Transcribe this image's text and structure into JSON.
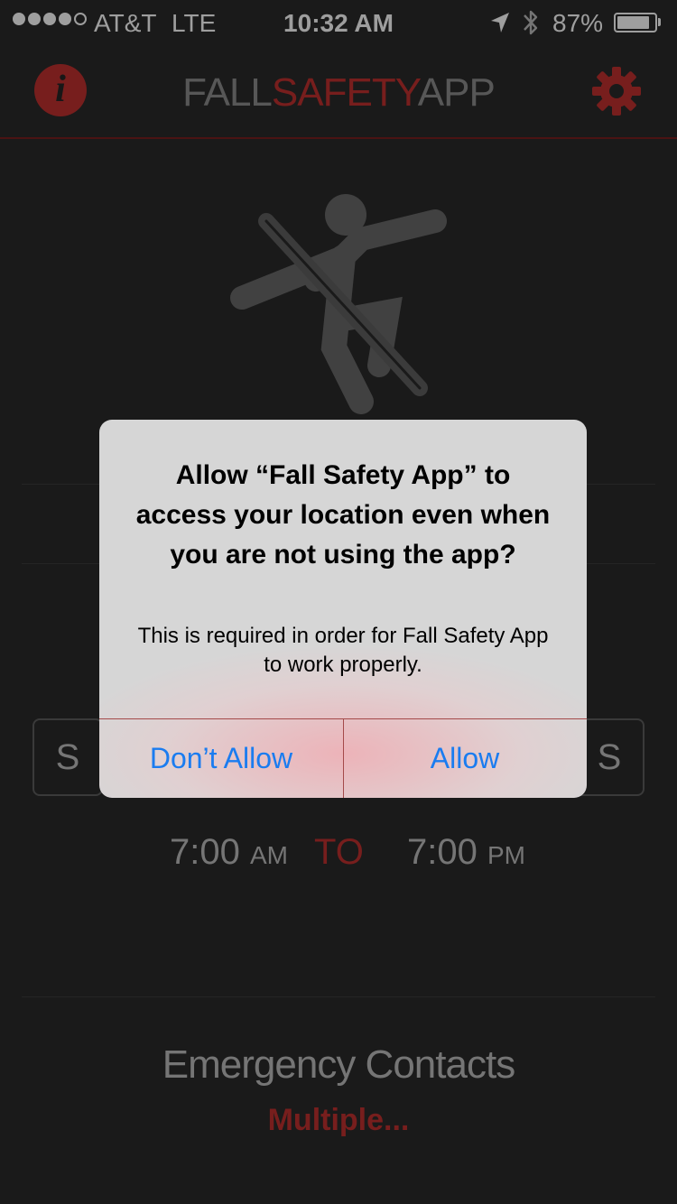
{
  "status_bar": {
    "carrier": "AT&T",
    "network": "LTE",
    "time": "10:32 AM",
    "battery_percent": "87%",
    "battery_level": 0.87,
    "signal_filled": 4,
    "signal_total": 5,
    "icons": [
      "location-arrow-icon",
      "bluetooth-icon",
      "battery-icon"
    ]
  },
  "header": {
    "title_part1": "FALL",
    "title_part2": "SAFETY",
    "title_part3": "APP",
    "info_glyph": "i",
    "icons": [
      "info-icon",
      "gear-icon"
    ]
  },
  "schedule": {
    "day_first": "S",
    "day_last": "S",
    "start_time": "7:00",
    "start_ampm": "AM",
    "to_label": "TO",
    "end_time": "7:00",
    "end_ampm": "PM"
  },
  "contacts": {
    "title": "Emergency Contacts",
    "value": "Multiple..."
  },
  "alert": {
    "title": "Allow “Fall Safety App” to access your location even when you are not using the app?",
    "message": "This is required in order for Fall Safety App to work properly.",
    "cancel_label": "Don’t Allow",
    "confirm_label": "Allow"
  },
  "colors": {
    "accent": "#c0312f",
    "background": "#2a2a2a",
    "alert_button": "#1a7cf0"
  }
}
